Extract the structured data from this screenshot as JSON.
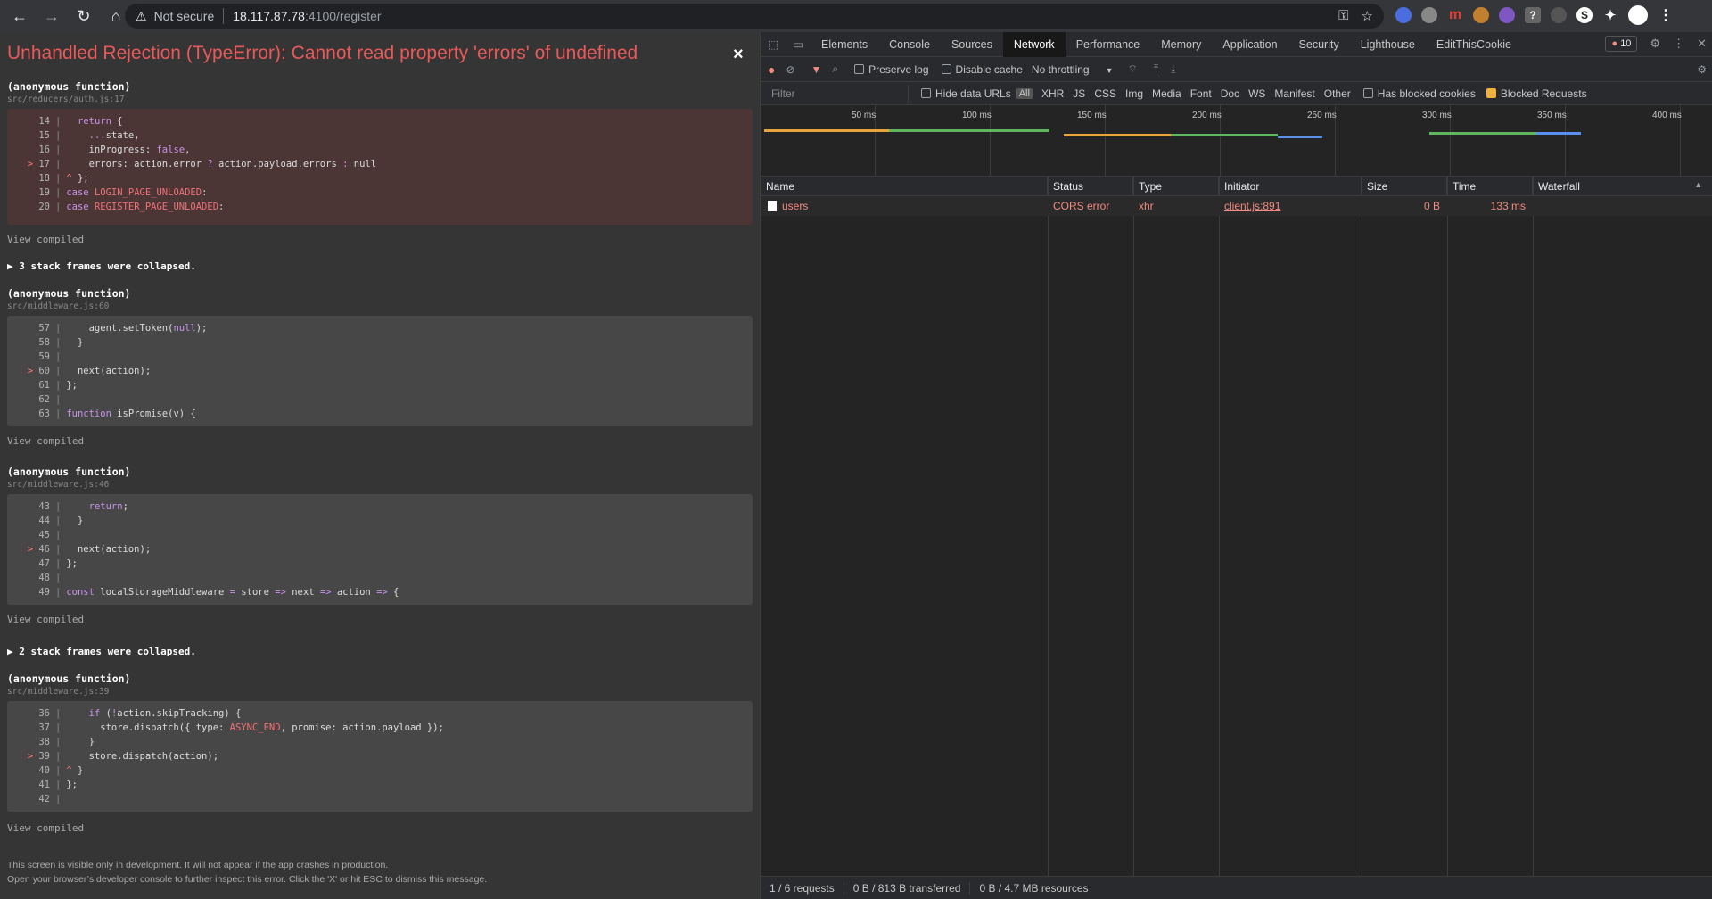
{
  "browser": {
    "security_label": "Not secure",
    "url_host": "18.117.87.78",
    "url_port": ":4100/register"
  },
  "overlay": {
    "title": "Unhandled Rejection (TypeError): Cannot read property 'errors' of undefined",
    "close": "×",
    "view_compiled": "View compiled",
    "frames": [
      {
        "fn": "(anonymous function)",
        "file": "src/reducers/auth.js:17"
      },
      {
        "fn": "(anonymous function)",
        "file": "src/middleware.js:60"
      },
      {
        "fn": "(anonymous function)",
        "file": "src/middleware.js:46"
      },
      {
        "fn": "(anonymous function)",
        "file": "src/middleware.js:39"
      }
    ],
    "collapsed_1": "▶ 3 stack frames were collapsed.",
    "collapsed_2": "▶ 2 stack frames were collapsed.",
    "footer_1": "This screen is visible only in development. It will not appear if the app crashes in production.",
    "footer_2": "Open your browser’s developer console to further inspect this error.  Click the 'X' or hit ESC to dismiss this message."
  },
  "devtools": {
    "tabs": [
      "Elements",
      "Console",
      "Sources",
      "Network",
      "Performance",
      "Memory",
      "Application",
      "Security",
      "Lighthouse",
      "EditThisCookie"
    ],
    "active_tab": "Network",
    "error_count": "10",
    "toolbar": {
      "preserve_log": "Preserve log",
      "disable_cache": "Disable cache",
      "throttling": "No throttling"
    },
    "filter": {
      "placeholder": "Filter",
      "hide_data_urls": "Hide data URLs",
      "all": "All",
      "types": [
        "XHR",
        "JS",
        "CSS",
        "Img",
        "Media",
        "Font",
        "Doc",
        "WS",
        "Manifest",
        "Other"
      ],
      "has_blocked_cookies": "Has blocked cookies",
      "blocked_requests": "Blocked Requests"
    },
    "timeline_ticks": [
      "50 ms",
      "100 ms",
      "150 ms",
      "200 ms",
      "250 ms",
      "300 ms",
      "350 ms",
      "400 ms"
    ],
    "columns": [
      "Name",
      "Status",
      "Type",
      "Initiator",
      "Size",
      "Time",
      "Waterfall"
    ],
    "rows": [
      {
        "name": "users",
        "status": "CORS error",
        "type": "xhr",
        "initiator": "client.js:891",
        "size": "0 B",
        "time": "133 ms"
      }
    ],
    "status": {
      "requests": "1 / 6 requests",
      "transferred": "0 B / 813 B transferred",
      "resources": "0 B / 4.7 MB resources"
    }
  }
}
